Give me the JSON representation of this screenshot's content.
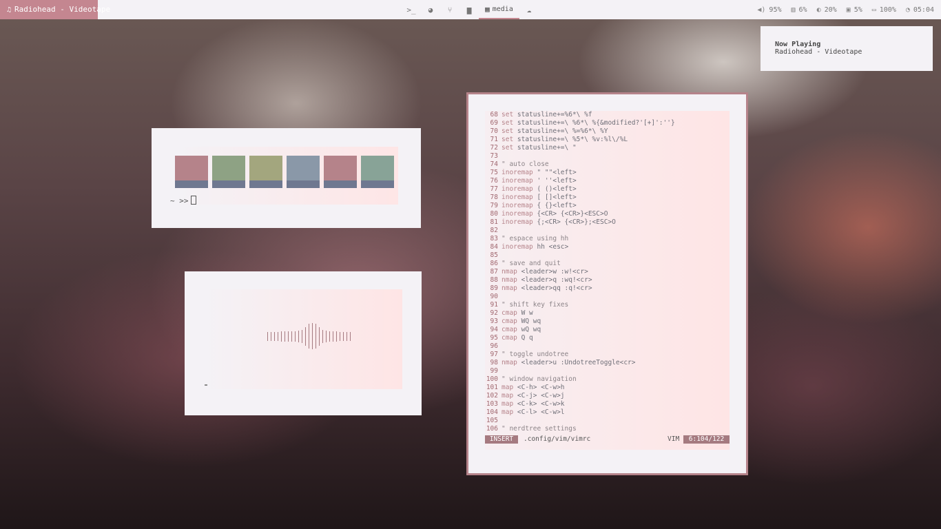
{
  "topbar": {
    "now_playing": "Radiohead - Videotape",
    "workspaces": [
      {
        "icon": "terminal-icon",
        "glyph": ">_"
      },
      {
        "icon": "globe-icon",
        "glyph": "◕"
      },
      {
        "icon": "git-branch-icon",
        "glyph": "⑂"
      },
      {
        "icon": "folder-icon",
        "glyph": "▆"
      },
      {
        "icon": "film-icon",
        "glyph": "▦",
        "label": "media",
        "active": true
      },
      {
        "icon": "cloud-icon",
        "glyph": "☁"
      }
    ],
    "stats": {
      "volume": "95%",
      "memory": "6%",
      "brightness": "20%",
      "cpu": "5%",
      "battery": "100%",
      "clock": "05:04"
    }
  },
  "notification": {
    "title": "Now Playing",
    "body": "Radiohead - Videotape"
  },
  "palette_window": {
    "prompt": "~ >>",
    "swatches": [
      {
        "color": "#b5838a"
      },
      {
        "color": "#8ea284"
      },
      {
        "color": "#a3a67e"
      },
      {
        "color": "#8a98a8"
      },
      {
        "color": "#b5838a"
      },
      {
        "color": "#88a397"
      }
    ]
  },
  "visualizer": {
    "levels": [
      0.35,
      0.35,
      0.35,
      0.35,
      0.4,
      0.4,
      0.4,
      0.4,
      0.4,
      0.45,
      0.5,
      0.7,
      0.95,
      1.0,
      0.95,
      0.7,
      0.5,
      0.45,
      0.4,
      0.4,
      0.4,
      0.35,
      0.35,
      0.35,
      0.35
    ]
  },
  "vim": {
    "lines": [
      {
        "n": "68",
        "k": "set",
        "t": " statusline+=%6*\\ %f"
      },
      {
        "n": "69",
        "k": "set",
        "t": " statusline+=\\ %6*\\ %{&modified?'[+]':''}"
      },
      {
        "n": "70",
        "k": "set",
        "t": " statusline+=\\ %=%6*\\ %Y"
      },
      {
        "n": "71",
        "k": "set",
        "t": " statusline+=\\ %5*\\ %v:%l\\/%L"
      },
      {
        "n": "72",
        "k": "set",
        "t": " statusline+=\\ \""
      },
      {
        "n": "73",
        "k": "",
        "t": ""
      },
      {
        "n": "74",
        "c": "\" auto close"
      },
      {
        "n": "75",
        "k": "inoremap",
        "t": " \" \"\"<left>"
      },
      {
        "n": "76",
        "k": "inoremap",
        "t": " ' ''<left>"
      },
      {
        "n": "77",
        "k": "inoremap",
        "t": " ( ()<left>"
      },
      {
        "n": "78",
        "k": "inoremap",
        "t": " [ []<left>"
      },
      {
        "n": "79",
        "k": "inoremap",
        "t": " { {}<left>"
      },
      {
        "n": "80",
        "k": "inoremap",
        "t": " {<CR> {<CR>}<ESC>O"
      },
      {
        "n": "81",
        "k": "inoremap",
        "t": " {;<CR> {<CR>};<ESC>O"
      },
      {
        "n": "82",
        "k": "",
        "t": ""
      },
      {
        "n": "83",
        "c": "\" espace using hh"
      },
      {
        "n": "84",
        "k": "inoremap",
        "t": " hh <esc>"
      },
      {
        "n": "85",
        "k": "",
        "t": ""
      },
      {
        "n": "86",
        "c": "\" save and quit"
      },
      {
        "n": "87",
        "k": "nmap",
        "t": " <leader>w :w!<cr>"
      },
      {
        "n": "88",
        "k": "nmap",
        "t": " <leader>q :wq!<cr>"
      },
      {
        "n": "89",
        "k": "nmap",
        "t": " <leader>qq :q!<cr>"
      },
      {
        "n": "90",
        "k": "",
        "t": ""
      },
      {
        "n": "91",
        "c": "\" shift key fixes"
      },
      {
        "n": "92",
        "k": "cmap",
        "t": " W w"
      },
      {
        "n": "93",
        "k": "cmap",
        "t": " WQ wq"
      },
      {
        "n": "94",
        "k": "cmap",
        "t": " wQ wq"
      },
      {
        "n": "95",
        "k": "cmap",
        "t": " Q q"
      },
      {
        "n": "96",
        "k": "",
        "t": ""
      },
      {
        "n": "97",
        "c": "\" toggle undotree"
      },
      {
        "n": "98",
        "k": "nmap",
        "t": " <leader>u :UndotreeToggle<cr>"
      },
      {
        "n": "99",
        "k": "",
        "t": ""
      },
      {
        "n": "100",
        "c": "\" window navigation"
      },
      {
        "n": "101",
        "k": "map",
        "t": " <C-h> <C-w>h"
      },
      {
        "n": "102",
        "k": "map",
        "t": " <C-j> <C-w>j"
      },
      {
        "n": "103",
        "k": "map",
        "t": " <C-k> <C-w>k"
      },
      {
        "n": "104",
        "k": "map",
        "t": " <C-l> <C-w>l"
      },
      {
        "n": "105",
        "k": "",
        "t": ""
      },
      {
        "n": "106",
        "c": "\" nerdtree settings"
      }
    ],
    "status": {
      "mode": "INSERT",
      "file": ".config/vim/vimrc",
      "filetype": "VIM",
      "position": "6:104/122"
    }
  }
}
